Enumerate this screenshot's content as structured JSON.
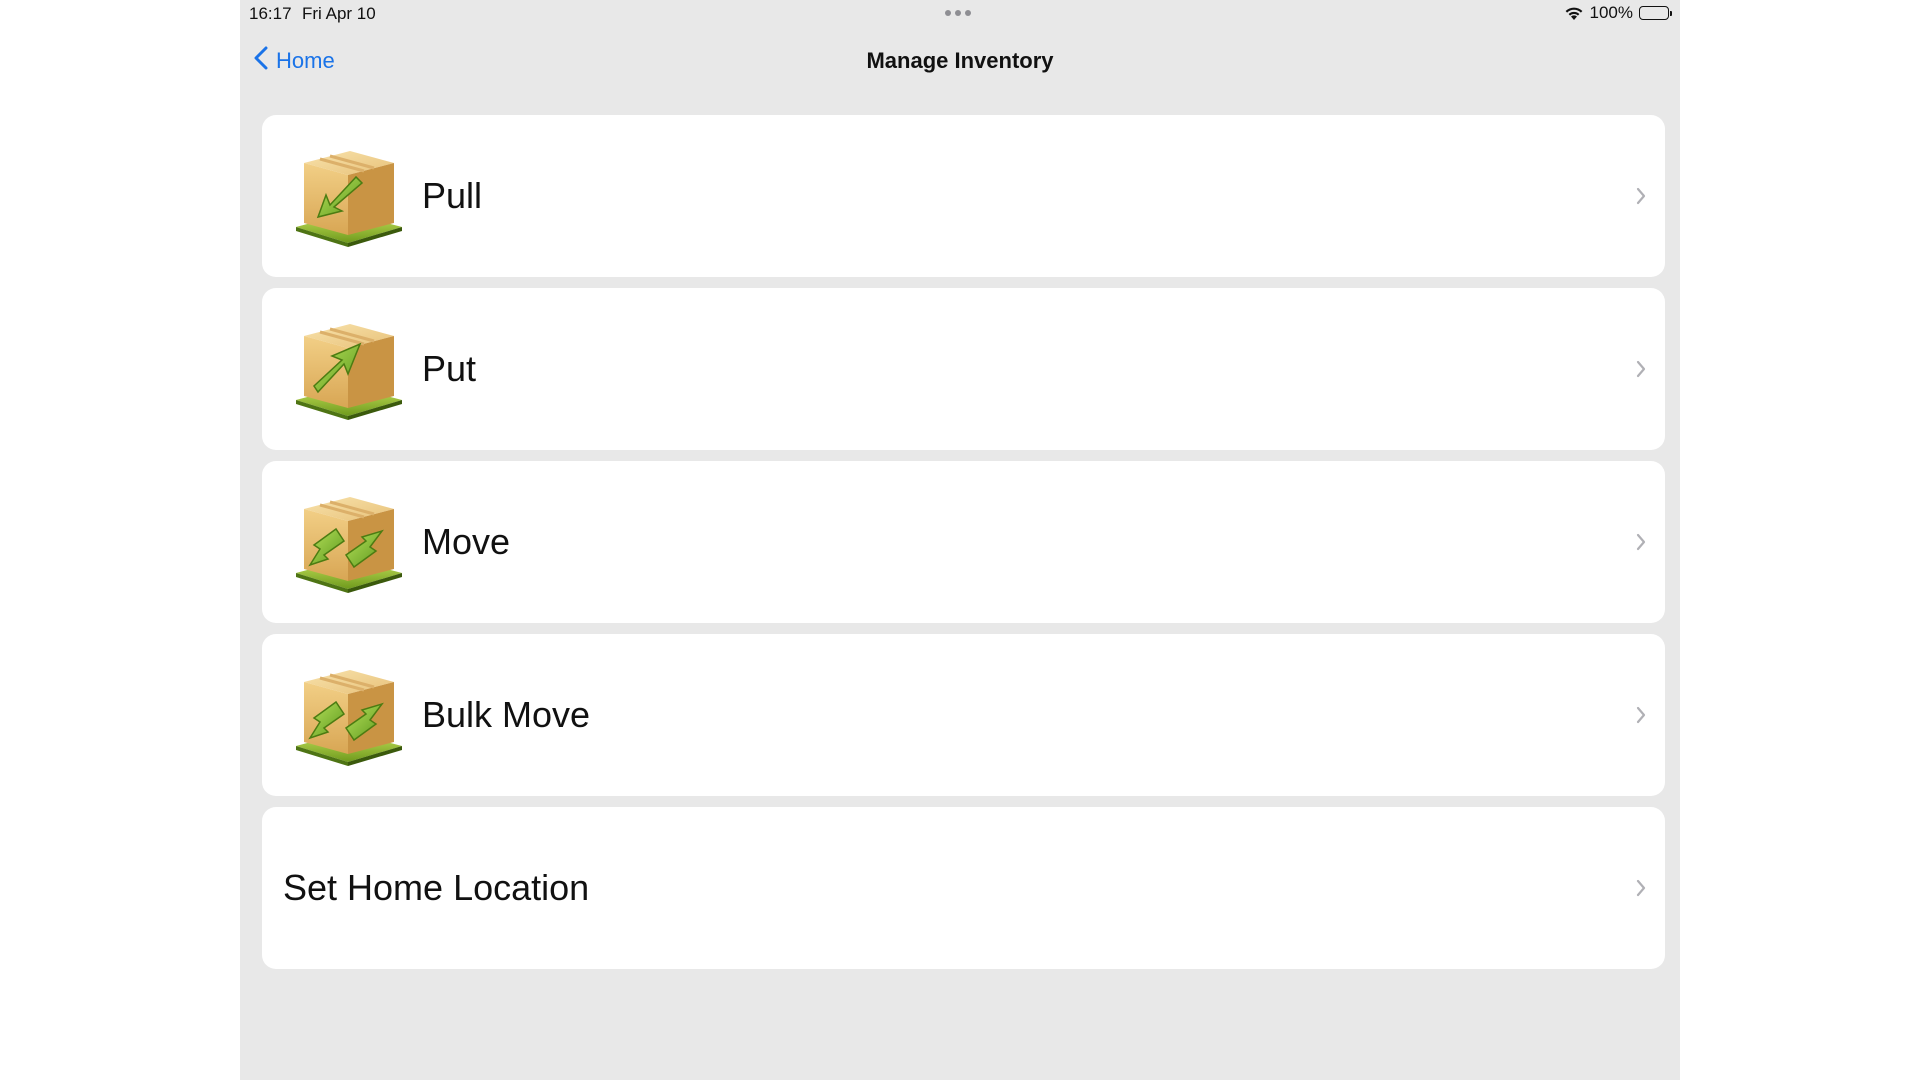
{
  "status_bar": {
    "time": "16:17",
    "date": "Fri Apr 10",
    "battery": "100%"
  },
  "nav": {
    "back_label": "Home",
    "title": "Manage Inventory"
  },
  "menu": {
    "items": [
      {
        "label": "Pull",
        "icon": "box-pull-icon"
      },
      {
        "label": "Put",
        "icon": "box-put-icon"
      },
      {
        "label": "Move",
        "icon": "box-move-icon"
      },
      {
        "label": "Bulk Move",
        "icon": "box-bulk-move-icon"
      },
      {
        "label": "Set Home Location",
        "icon": null
      }
    ]
  },
  "colors": {
    "accent": "#1a73e8",
    "background": "#e8e8e8",
    "card": "#ffffff",
    "chevron": "#b0b0b5"
  }
}
